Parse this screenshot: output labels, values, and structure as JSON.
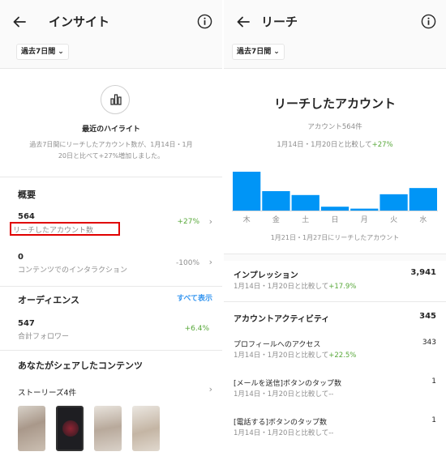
{
  "left": {
    "title": "インサイト",
    "period": "過去7日間",
    "highlight": {
      "title": "最近のハイライト",
      "desc": "過去7日間にリーチしたアカウント数が、1月14日・1月20日と比べて+27%増加しました。"
    },
    "overview": {
      "heading": "概要",
      "metrics": [
        {
          "value": "564",
          "label": "リーチしたアカウント数",
          "change": "+27%"
        },
        {
          "value": "0",
          "label": "コンテンツでのインタラクション",
          "change": "-100%"
        }
      ]
    },
    "audience": {
      "heading": "オーディエンス",
      "see_all": "すべて表示",
      "value": "547",
      "label": "合計フォロワー",
      "change": "+6.4%"
    },
    "shared": {
      "heading": "あなたがシェアしたコンテンツ",
      "stories": "ストーリーズ4件"
    }
  },
  "right": {
    "title": "リーチ",
    "period": "過去7日間",
    "reach_title": "リーチしたアカウント",
    "reach_count": "アカウント564件",
    "compare_prefix": "1月14日・1月20日と比較して",
    "compare_pct": "+27%",
    "chart_caption": "1月21日・1月27日にリーチしたアカウント",
    "impressions": {
      "label": "インプレッション",
      "value": "3,941",
      "compare": "1月14日・1月20日と比較して",
      "pct": "+17.9%"
    },
    "activity": {
      "label": "アカウントアクティビティ",
      "value": "345",
      "items": [
        {
          "label": "プロフィールへのアクセス",
          "value": "343",
          "compare": "1月14日・1月20日と比較して",
          "pct": "+22.5%"
        },
        {
          "label": "[メールを送信]ボタンのタップ数",
          "value": "1",
          "compare": "1月14日・1月20日と比較して",
          "pct": "--"
        },
        {
          "label": "[電話する]ボタンのタップ数",
          "value": "1",
          "compare": "1月14日・1月20日と比較して",
          "pct": "--"
        }
      ]
    }
  },
  "colors": {
    "bar": "#0095f6",
    "green": "#58a83a",
    "link": "#3897f0",
    "highlight_box": "#e00000"
  },
  "chart_data": {
    "type": "bar",
    "categories": [
      "木",
      "金",
      "土",
      "日",
      "月",
      "火",
      "水"
    ],
    "values": [
      100,
      50,
      40,
      10,
      5,
      42,
      58
    ],
    "title": "",
    "xlabel": "",
    "ylabel": "",
    "ylim": [
      0,
      100
    ],
    "grid": false
  }
}
